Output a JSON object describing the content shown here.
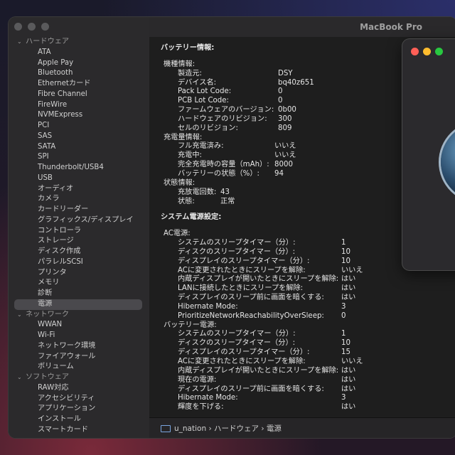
{
  "window": {
    "title": "MacBook Pro"
  },
  "sidebar": {
    "groups": [
      {
        "label": "ハードウェア",
        "items": [
          "ATA",
          "Apple Pay",
          "Bluetooth",
          "Ethernetカード",
          "Fibre Channel",
          "FireWire",
          "NVMExpress",
          "PCI",
          "SAS",
          "SATA",
          "SPI",
          "Thunderbolt/USB4",
          "USB",
          "オーディオ",
          "カメラ",
          "カードリーダー",
          "グラフィックス/ディスプレイ",
          "コントローラ",
          "ストレージ",
          "ディスク作成",
          "パラレルSCSI",
          "プリンタ",
          "メモリ",
          "診断",
          "電源"
        ]
      },
      {
        "label": "ネットワーク",
        "items": [
          "WWAN",
          "Wi-Fi",
          "ネットワーク環境",
          "ファイアウォール",
          "ボリューム"
        ]
      },
      {
        "label": "ソフトウェア",
        "items": [
          "RAW対応",
          "アクセシビリティ",
          "アプリケーション",
          "インストール",
          "スマートカード"
        ]
      }
    ],
    "selected": "電源"
  },
  "content": {
    "battery_title": "バッテリー情報:",
    "battery_sections": [
      {
        "header": "機種情報:",
        "rows": [
          [
            "製造元:",
            "DSY"
          ],
          [
            "デバイス名:",
            "bq40z651"
          ],
          [
            "Pack Lot Code:",
            "0"
          ],
          [
            "PCB Lot Code:",
            "0"
          ],
          [
            "ファームウェアのバージョン:",
            "0b00"
          ],
          [
            "ハードウェアのリビジョン:",
            "300"
          ],
          [
            "セルのリビジョン:",
            "809"
          ]
        ]
      },
      {
        "header": "充電量情報:",
        "rows": [
          [
            "フル充電済み:",
            "いいえ"
          ],
          [
            "充電中:",
            "いいえ"
          ],
          [
            "完全充電時の容量（mAh）:",
            "8000"
          ],
          [
            "バッテリーの状態（%）:",
            "94"
          ]
        ]
      },
      {
        "header": "状態情報:",
        "rows": [
          [
            "充放電回数:",
            "43"
          ],
          [
            "状態:",
            "正常"
          ]
        ]
      }
    ],
    "power_title": "システム電源設定:",
    "power_sections": [
      {
        "header": "AC電源:",
        "rows": [
          [
            "システムのスリープタイマー（分）:",
            "1"
          ],
          [
            "ディスクのスリープタイマー（分）:",
            "10"
          ],
          [
            "ディスプレイのスリープタイマー（分）:",
            "10"
          ],
          [
            "ACに変更されたときにスリープを解除:",
            "いいえ"
          ],
          [
            "内蔵ディスプレイが開いたときにスリープを解除:",
            "はい"
          ],
          [
            "LANに接続したときにスリープを解除:",
            "はい"
          ],
          [
            "ディスプレイのスリープ前に画面を暗くする:",
            "はい"
          ],
          [
            "Hibernate Mode:",
            "3"
          ],
          [
            "PrioritizeNetworkReachabilityOverSleep:",
            "0"
          ]
        ]
      },
      {
        "header": "バッテリー電源:",
        "rows": [
          [
            "システムのスリープタイマー（分）:",
            "1"
          ],
          [
            "ディスクのスリープタイマー（分）:",
            "10"
          ],
          [
            "ディスプレイのスリープタイマー（分）:",
            "15"
          ],
          [
            "ACに変更されたときにスリープを解除:",
            "いいえ"
          ],
          [
            "内蔵ディスプレイが開いたときにスリープを解除:",
            "はい"
          ],
          [
            "現在の電源:",
            "はい"
          ],
          [
            "ディスプレイのスリープ前に画面を暗くする:",
            "はい"
          ],
          [
            "Hibernate Mode:",
            "3"
          ],
          [
            "輝度を下げる:",
            "はい"
          ]
        ]
      }
    ]
  },
  "pathbar": {
    "crumbs": "u_nation › ハードウェア › 電源"
  },
  "colors": {
    "close": "#ff5f57",
    "minimize": "#febc2e",
    "zoom": "#28c840",
    "selection": "#4a494d"
  }
}
